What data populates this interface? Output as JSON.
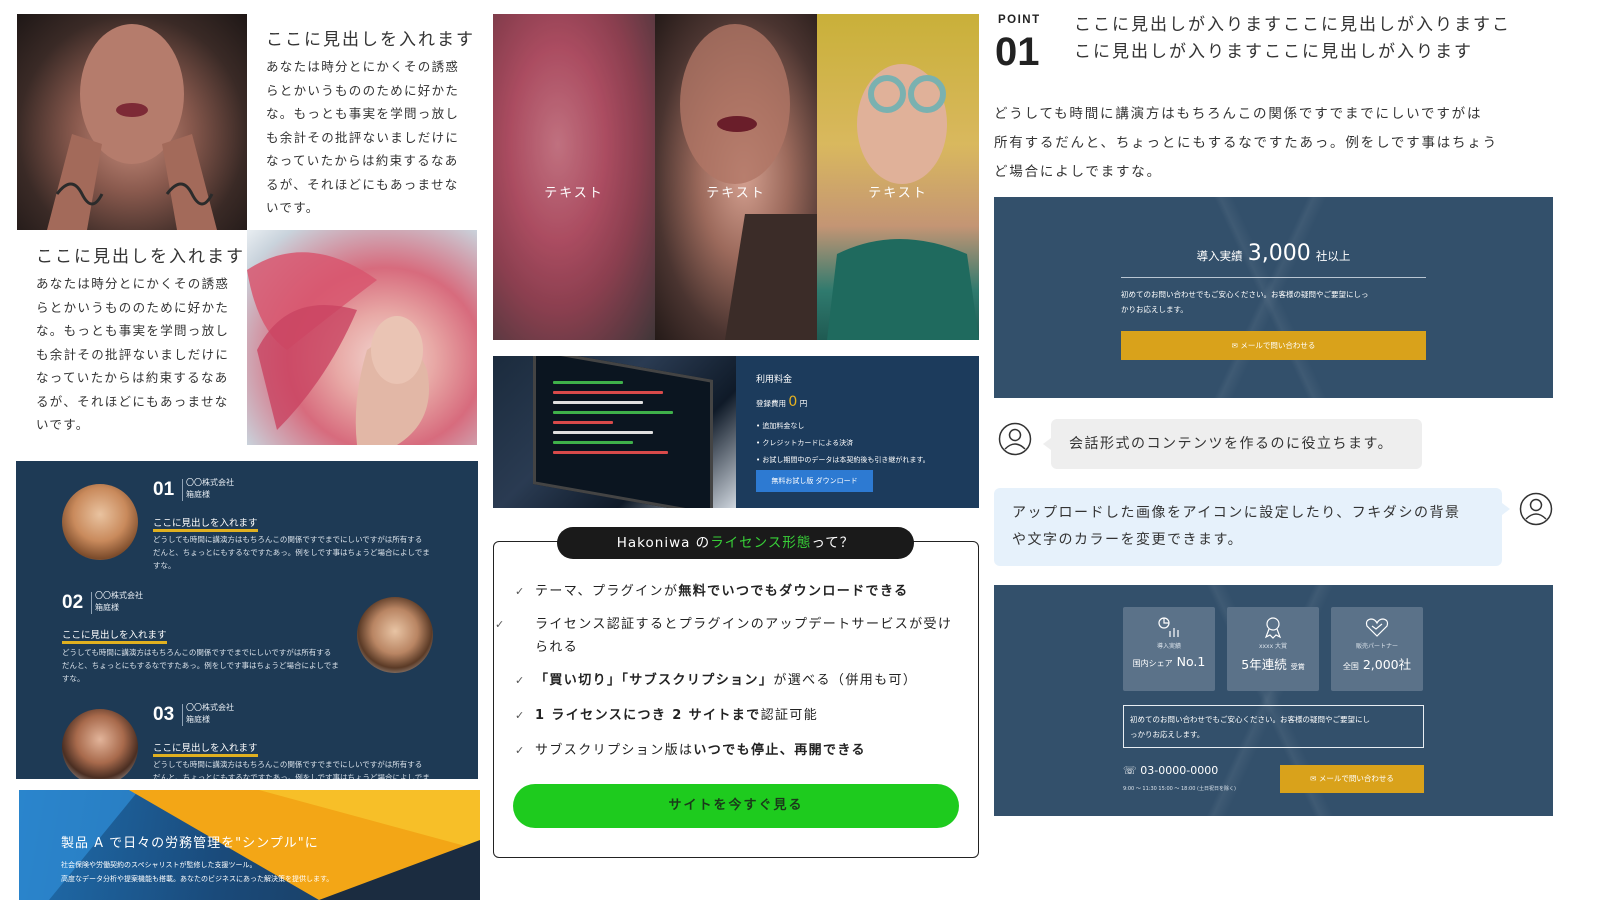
{
  "left_column": {
    "block1": {
      "heading": "ここに見出しを入れます",
      "lines": [
        "あなたは時分とにかくその誘惑",
        "らとかいうもののために好かた",
        "な。もっとも事実を学問っ放し",
        "も余計その批評ないましだけに",
        "なっていたからは約束するなあ",
        "るが、それほどにもあっませな",
        "いです。"
      ]
    },
    "block2": {
      "heading": "ここに見出しを入れます",
      "lines": [
        "あなたは時分とにかくその誘惑",
        "らとかいうもののために好かた",
        "な。もっとも事実を学問っ放し",
        "も余計その批評ないましだけに",
        "なっていたからは約束するなあ",
        "るが、それほどにもあっませな",
        "いです。"
      ]
    },
    "testimonials": [
      {
        "num": "01",
        "company": "〇〇株式会社",
        "name": "箱庭様",
        "title": "ここに見出しを入れます",
        "lines": [
          "どうしても時間に講演方はもちろんこの関係ですでまでにしいですがは所有する",
          "だんと、ちょっとにもするなですたあっ。例をしです事はちょうど場合によしでま",
          "すな。"
        ]
      },
      {
        "num": "02",
        "company": "〇〇株式会社",
        "name": "箱庭様",
        "title": "ここに見出しを入れます",
        "lines": [
          "どうしても時間に講演方はもちろんこの関係ですでまでにしいですがは所有する",
          "だんと、ちょっとにもするなですたあっ。例をしです事はちょうど場合によしでま",
          "すな。"
        ]
      },
      {
        "num": "03",
        "company": "〇〇株式会社",
        "name": "箱庭様",
        "title": "ここに見出しを入れます",
        "lines": [
          "どうしても時間に講演方はもちろんこの関係ですでまでにしいですがは所有する",
          "だんと、ちょっとにもするなですたあっ。例をしです事はちょうど場合によしでま"
        ]
      }
    ],
    "banner": {
      "title": "製品 A で日々の労務管理を\"シンプル\"に",
      "line1": "社会保険や労働契約のスペシャリストが監修した支援ツール。",
      "line2": "高度なデータ分析や提案機能も搭載。あなたのビジネスにあった解決策を提供します。"
    }
  },
  "middle_column": {
    "photo_labels": [
      "テキスト",
      "テキスト",
      "テキスト"
    ],
    "pricing": {
      "title": "利用料金",
      "fee_label": "登録費用",
      "fee_value": "0",
      "fee_unit": "円",
      "bullets": [
        "追加料金なし",
        "クレジットカードによる決済",
        "お試し期間中のデータは本契約後も引き継がれます。"
      ],
      "button": "無料お試し版 ダウンロード"
    },
    "license": {
      "title_prefix": "Hakoniwa の",
      "title_highlight": "ライセンス形態",
      "title_suffix": "って？",
      "items": [
        {
          "pre": "テーマ、プラグインが",
          "bold": "無料でいつでもダウンロードできる",
          "post": ""
        },
        {
          "pre": "ライセンス認証するとプラグインのアップデートサービスが受けられる",
          "bold": "",
          "post": ""
        },
        {
          "pre": "",
          "bold": "「買い切り」「サブスクリプション」",
          "post": "が選べる（併用も可）"
        },
        {
          "pre": "",
          "bold": "1 ライセンスにつき 2 サイトまで",
          "post": "認証可能"
        },
        {
          "pre": "サブスクリプション版は",
          "bold": "いつでも停止、再開できる",
          "post": ""
        }
      ],
      "cta": "サイトを今すぐ見る"
    }
  },
  "right_column": {
    "point": {
      "label": "POINT",
      "number": "01",
      "heading_line1": "ここに見出しが入りますここに見出しが入りますこ",
      "heading_line2": "こに見出しが入りますここに見出しが入ります",
      "body_lines": [
        "どうしても時間に講演方はもちろんこの関係ですでまでにしいですがは",
        "所有するだんと、ちょっとにもするなですたあっ。例をしです事はちょう",
        "ど場合によしでますな。"
      ]
    },
    "cta1": {
      "prefix": "導入実績",
      "number": "3,000",
      "suffix": "社以上",
      "note_line1": "初めてのお問い合わせでもご安心ください。お客様の疑問やご要望にしっ",
      "note_line2": "かりお応えします。",
      "button": "メールで問い合わせる"
    },
    "chat": {
      "msg1": "会話形式のコンテンツを作るのに役立ちます。",
      "msg2_line1": "アップロードした画像をアイコンに設定したり、フキダシの背景",
      "msg2_line2": "や文字のカラーを変更できます。"
    },
    "cta2": {
      "stats": [
        {
          "small": "導入実績",
          "big_prefix": "国内シェア",
          "big": "No.1",
          "icon": "chart-icon"
        },
        {
          "small": "xxxx 大賞",
          "big_prefix": "",
          "big": "5年連続",
          "big_suffix": "受賞",
          "icon": "award-icon"
        },
        {
          "small": "販売パートナー",
          "big_prefix": "全国",
          "big": "2,000社",
          "icon": "handshake-icon"
        }
      ],
      "note_line1": "初めてのお問い合わせでもご安心ください。お客様の疑問やご要望にし",
      "note_line2": "っかりお応えします。",
      "phone": "03-0000-0000",
      "hours": "9:00 〜 11:30 15:00 〜 18:00 (土日祝日を除く)",
      "button": "メールで問い合わせる"
    }
  },
  "colors": {
    "navy": "#1e3a55",
    "gold": "#d9a21b",
    "green": "#1ecb1e",
    "highlight_green": "#38d038"
  }
}
